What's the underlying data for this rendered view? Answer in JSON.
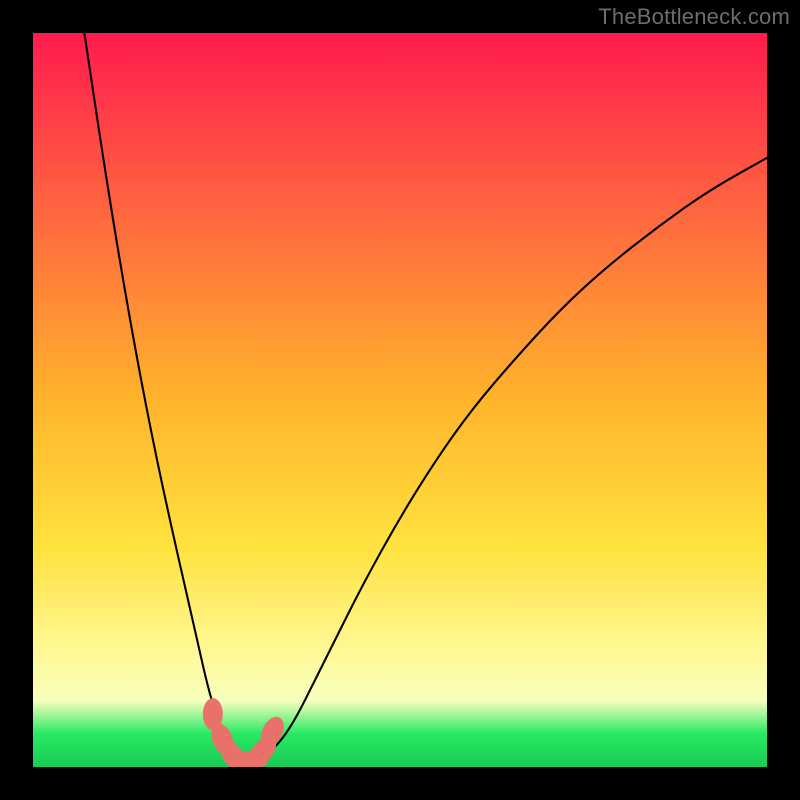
{
  "watermark": "TheBottleneck.com",
  "colors": {
    "black": "#000000",
    "marker": "#e9716a",
    "grad_top": "#ff1b4e",
    "grad_mid1": "#ff713d",
    "grad_mid2": "#ffb42b",
    "grad_mid3": "#ffe23e",
    "grad_yellow": "#fff99a",
    "grad_pale": "#f6ffbd",
    "grad_green": "#27e963",
    "grad_green2": "#1acb54"
  },
  "chart_data": {
    "type": "line",
    "title": "",
    "xlabel": "",
    "ylabel": "",
    "xlim": [
      0,
      100
    ],
    "ylim": [
      0,
      100
    ],
    "x": [
      7,
      10,
      13,
      16,
      19,
      22,
      24,
      26,
      27.5,
      29,
      30.5,
      32,
      34,
      36,
      38,
      41,
      45,
      50,
      55,
      60,
      66,
      72,
      78,
      85,
      92,
      100
    ],
    "values": [
      100,
      80,
      62,
      46,
      32,
      19,
      10,
      4,
      1.5,
      0.5,
      0.6,
      1.8,
      3.8,
      7,
      11,
      17,
      25,
      34,
      42,
      49,
      56,
      62.5,
      68,
      73.5,
      78.5,
      83
    ],
    "markers_x": [
      24.5,
      25.8,
      27.2,
      28.7,
      30.0,
      31.3,
      32.6
    ],
    "markers_y": [
      7.2,
      3.8,
      1.6,
      0.6,
      0.9,
      2.2,
      4.8
    ]
  }
}
